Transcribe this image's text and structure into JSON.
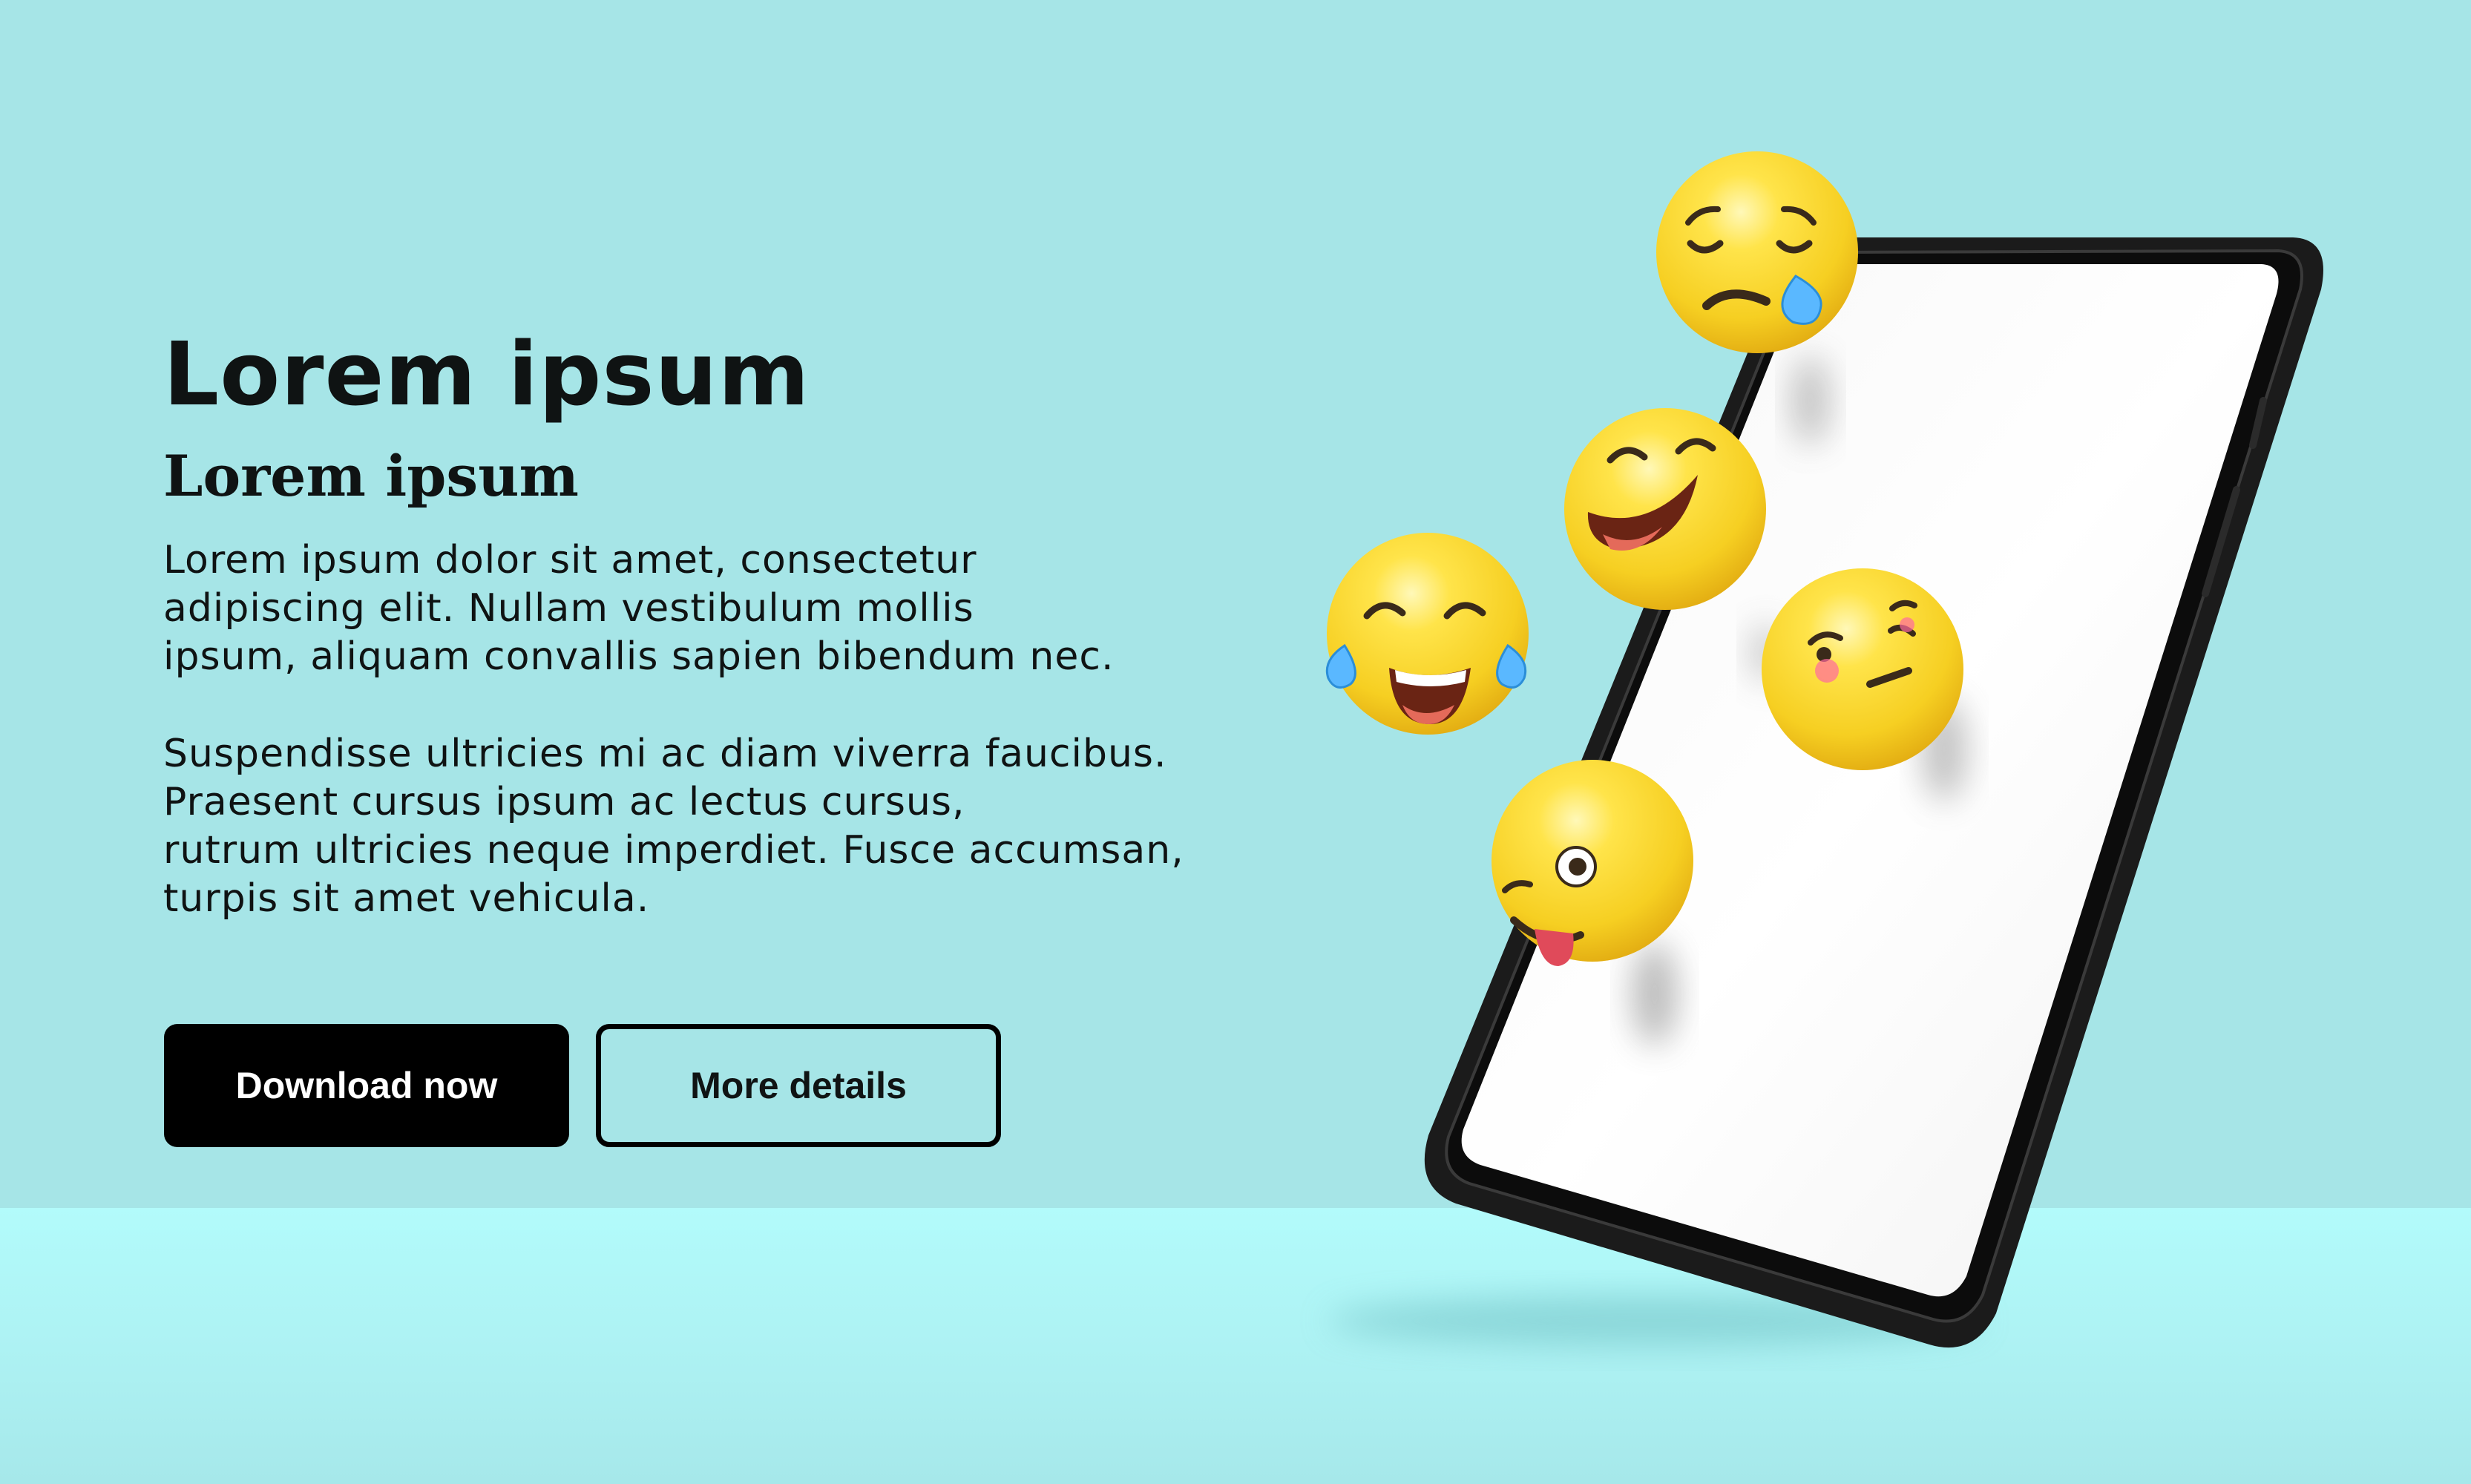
{
  "hero": {
    "title": "Lorem ipsum",
    "subtitle": "Lorem ipsum",
    "paragraph_1_lines": [
      "Lorem ipsum dolor sit amet, consectetur",
      "adipiscing elit. Nullam vestibulum mollis",
      "ipsum, aliquam convallis sapien bibendum nec."
    ],
    "paragraph_2_lines": [
      "Suspendisse ultricies mi ac diam viverra faucibus.",
      "Praesent cursus ipsum ac lectus cursus,",
      "rutrum ultricies neque imperdiet. Fusce accumsan,",
      "turpis sit amet vehicula."
    ]
  },
  "buttons": {
    "primary_label": "Download now",
    "secondary_label": "More details"
  },
  "colors": {
    "background": "#a6e5e7",
    "floor": "#b2fbfb",
    "button_primary": "#000000",
    "emoji_yellow": "#f6d12b"
  },
  "illustration": {
    "device": "smartphone",
    "emojis": [
      "sad-tear-emoji-icon",
      "laughing-emoji-icon",
      "tears-of-joy-emoji-icon",
      "woozy-emoji-icon",
      "zany-emoji-icon"
    ]
  }
}
